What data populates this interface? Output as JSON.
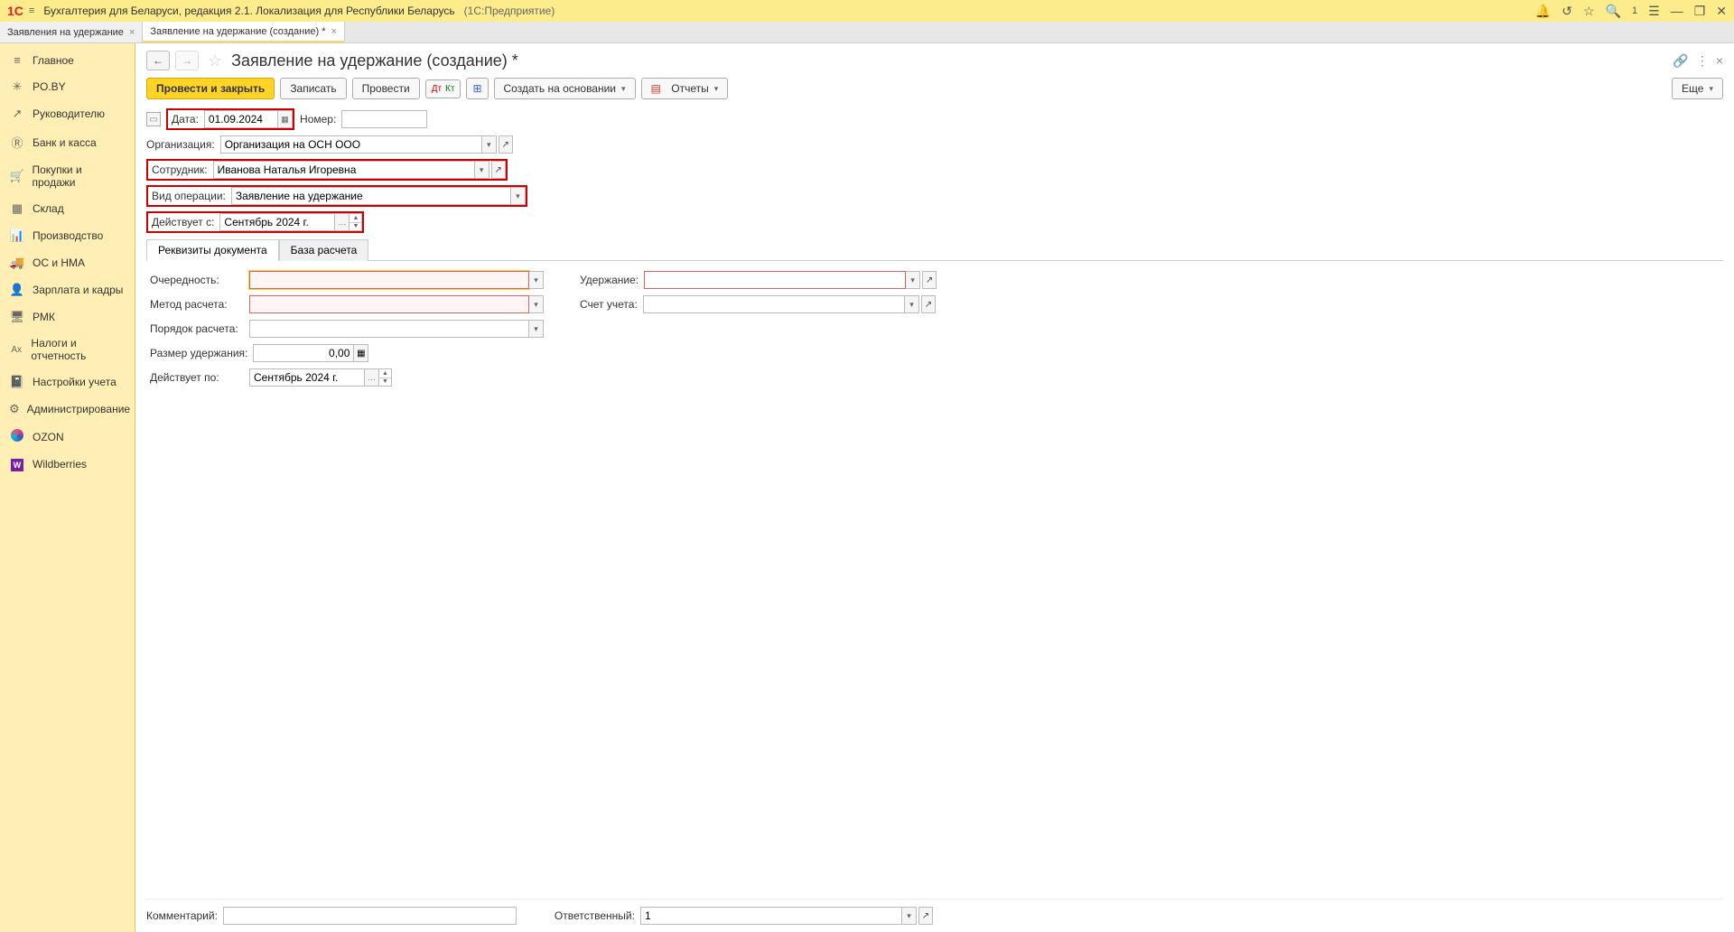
{
  "app": {
    "title": "Бухгалтерия для Беларуси, редакция 2.1. Локализация для Республики Беларусь",
    "suffix": "(1С:Предприятие)"
  },
  "tabs": [
    {
      "label": "Заявления на удержание",
      "active": false
    },
    {
      "label": "Заявление на удержание (создание) *",
      "active": true
    }
  ],
  "sidebar": {
    "items": [
      {
        "label": "Главное",
        "icon": "≡"
      },
      {
        "label": "PO.BY",
        "icon": "*"
      },
      {
        "label": "Руководителю",
        "icon": "↗"
      },
      {
        "label": "Банк и касса",
        "icon": "®"
      },
      {
        "label": "Покупки и продажи",
        "icon": "🛒"
      },
      {
        "label": "Склад",
        "icon": "▦"
      },
      {
        "label": "Производство",
        "icon": "📊"
      },
      {
        "label": "ОС и НМА",
        "icon": "🚚"
      },
      {
        "label": "Зарплата и кадры",
        "icon": "👤"
      },
      {
        "label": "РМК",
        "icon": "🖥"
      },
      {
        "label": "Налоги и отчетность",
        "icon": "Ax"
      },
      {
        "label": "Настройки учета",
        "icon": "📓"
      },
      {
        "label": "Администрирование",
        "icon": "⚙"
      },
      {
        "label": "OZON",
        "icon": "ozon"
      },
      {
        "label": "Wildberries",
        "icon": "wb"
      }
    ]
  },
  "page": {
    "title": "Заявление на удержание (создание) *"
  },
  "toolbar": {
    "post_close": "Провести и закрыть",
    "save": "Записать",
    "post": "Провести",
    "create_based": "Создать на основании",
    "reports": "Отчеты",
    "more": "Еще"
  },
  "form": {
    "date_label": "Дата:",
    "date_value": "01.09.2024",
    "number_label": "Номер:",
    "number_value": "",
    "org_label": "Организация:",
    "org_value": "Организация на ОСН ООО",
    "employee_label": "Сотрудник:",
    "employee_value": "Иванова Наталья Игоревна",
    "operation_label": "Вид операции:",
    "operation_value": "Заявление на удержание",
    "effective_from_label": "Действует с:",
    "effective_from_value": "Сентябрь 2024 г."
  },
  "inner_tabs": {
    "tab1": "Реквизиты документа",
    "tab2": "База расчета"
  },
  "details": {
    "priority_label": "Очередность:",
    "priority_value": "",
    "method_label": "Метод расчета:",
    "method_value": "",
    "proc_label": "Порядок расчета:",
    "proc_value": "",
    "amount_label": "Размер удержания:",
    "amount_value": "0,00",
    "until_label": "Действует по:",
    "until_value": "Сентябрь 2024 г.",
    "deduction_label": "Удержание:",
    "deduction_value": "",
    "account_label": "Счет учета:",
    "account_value": ""
  },
  "footer": {
    "comment_label": "Комментарий:",
    "comment_value": "",
    "responsible_label": "Ответственный:",
    "responsible_value": "1"
  }
}
